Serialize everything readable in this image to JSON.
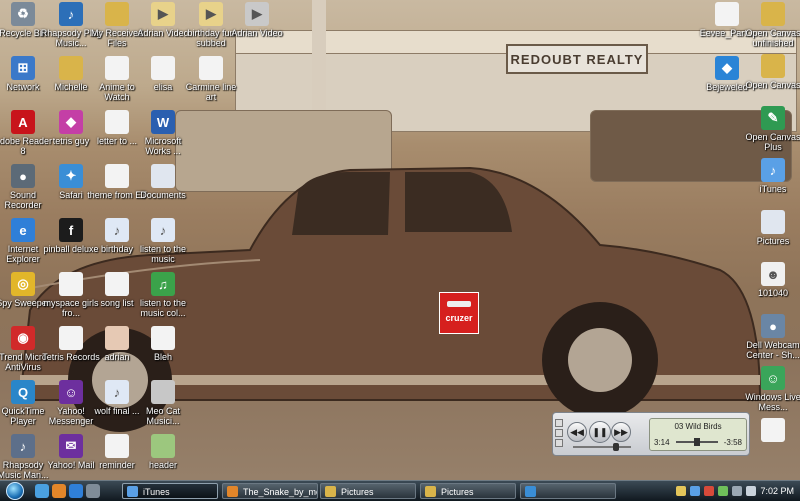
{
  "desktop": {
    "icons_left": [
      {
        "label": "Recycle Bin",
        "icon": "recycle-bin-icon",
        "color": "#7b8a99",
        "glyph": "♻"
      },
      {
        "label": "Network",
        "icon": "network-icon",
        "color": "#3b79c9",
        "glyph": "⊞"
      },
      {
        "label": "Adobe Reader 8",
        "icon": "adobe-reader-icon",
        "color": "#c8141b",
        "glyph": "A"
      },
      {
        "label": "Sound Recorder",
        "icon": "sound-recorder-icon",
        "color": "#5c6a77",
        "glyph": "●"
      },
      {
        "label": "Internet Explorer",
        "icon": "internet-explorer-icon",
        "color": "#2f7fd8",
        "glyph": "e"
      },
      {
        "label": "Spy Sweeper",
        "icon": "spy-sweeper-icon",
        "color": "#e2b62a",
        "glyph": "◎"
      },
      {
        "label": "Trend Micro AntiVirus",
        "icon": "trend-micro-icon",
        "color": "#d12a2a",
        "glyph": "◉"
      },
      {
        "label": "QuickTime Player",
        "icon": "quicktime-icon",
        "color": "#2a86c9",
        "glyph": "Q"
      },
      {
        "label": "Rhapsody Music Man...",
        "icon": "rhapsody-manager-icon",
        "color": "#5d6f8a",
        "glyph": "♪"
      }
    ],
    "icons_col2": [
      {
        "label": "Rhapsody Play Music...",
        "icon": "rhapsody-icon",
        "color": "#2c6fb8",
        "glyph": "♪"
      },
      {
        "label": "Michelle",
        "icon": "folder-icon",
        "color": "#d9b44a",
        "glyph": ""
      },
      {
        "label": "tetris guy",
        "icon": "tetris-guy-icon",
        "color": "#c43fa6",
        "glyph": "◆"
      },
      {
        "label": "Safari",
        "icon": "safari-icon",
        "color": "#3a8ed6",
        "glyph": "✦"
      },
      {
        "label": "pinball deluxe",
        "icon": "pinball-icon",
        "color": "#1c1c1c",
        "glyph": "f"
      },
      {
        "label": "myspace girls fro...",
        "icon": "document-icon",
        "color": "#f3f3f3",
        "glyph": ""
      },
      {
        "label": "Tetris Records",
        "icon": "document-icon",
        "color": "#f3f3f3",
        "glyph": ""
      },
      {
        "label": "Yahoo! Messenger",
        "icon": "yahoo-messenger-icon",
        "color": "#6d2f9e",
        "glyph": "☺"
      },
      {
        "label": "Yahoo! Mail",
        "icon": "yahoo-mail-icon",
        "color": "#6d2f9e",
        "glyph": "✉"
      }
    ],
    "icons_col3": [
      {
        "label": "My Received Files",
        "icon": "folder-icon",
        "color": "#d9b44a",
        "glyph": ""
      },
      {
        "label": "Anime to Watch",
        "icon": "document-icon",
        "color": "#f3f3f3",
        "glyph": ""
      },
      {
        "label": "letter to ...",
        "icon": "document-icon",
        "color": "#f3f3f3",
        "glyph": ""
      },
      {
        "label": "theme from ET",
        "icon": "document-icon",
        "color": "#f3f3f3",
        "glyph": ""
      },
      {
        "label": "birthday",
        "icon": "audio-file-icon",
        "color": "#dfe8f5",
        "glyph": "♪"
      },
      {
        "label": "song list",
        "icon": "document-icon",
        "color": "#f3f3f3",
        "glyph": ""
      },
      {
        "label": "adrian",
        "icon": "image-file-icon",
        "color": "#e6c9b4",
        "glyph": ""
      },
      {
        "label": "wolf final ...",
        "icon": "audio-file-icon",
        "color": "#dfe8f5",
        "glyph": "♪"
      },
      {
        "label": "reminder",
        "icon": "document-icon",
        "color": "#f3f3f3",
        "glyph": ""
      }
    ],
    "icons_col4": [
      {
        "label": "Adrian Video",
        "icon": "video-file-icon",
        "color": "#e8d28a",
        "glyph": "▶"
      },
      {
        "label": "elisa",
        "icon": "document-icon",
        "color": "#f3f3f3",
        "glyph": ""
      },
      {
        "label": "Microsoft Works ...",
        "icon": "works-icon",
        "color": "#2a5fb0",
        "glyph": "W"
      },
      {
        "label": "Documents",
        "icon": "documents-icon",
        "color": "#e0e6ef",
        "glyph": ""
      },
      {
        "label": "listen to the music",
        "icon": "audio-file-icon",
        "color": "#dfe8f5",
        "glyph": "♪"
      },
      {
        "label": "listen to the music col...",
        "icon": "music-icon",
        "color": "#3ba24a",
        "glyph": "♫"
      },
      {
        "label": "Bleh",
        "icon": "document-icon",
        "color": "#f3f3f3",
        "glyph": ""
      },
      {
        "label": "Meo Cat Musici...",
        "icon": "image-file-icon",
        "color": "#c7c7c7",
        "glyph": ""
      },
      {
        "label": "header",
        "icon": "image-file-icon",
        "color": "#9cc77e",
        "glyph": ""
      }
    ],
    "icons_col5": [
      {
        "label": "birthday fun subbed",
        "icon": "video-file-icon",
        "color": "#e8d28a",
        "glyph": "▶"
      },
      {
        "label": "Carmine line art",
        "icon": "document-icon",
        "color": "#f3f3f3",
        "glyph": ""
      }
    ],
    "icons_col6": [
      {
        "label": "Adrian Video",
        "icon": "video-file-icon",
        "color": "#c9c9c9",
        "glyph": "▶"
      }
    ],
    "icons_right1": [
      {
        "label": "Eevee_Part...",
        "icon": "document-icon",
        "color": "#f3f3f3",
        "glyph": ""
      },
      {
        "label": "Bejeweled",
        "icon": "bejeweled-icon",
        "color": "#2a84d6",
        "glyph": "◆"
      }
    ],
    "icons_right2": [
      {
        "label": "Open Canvas unfinished",
        "icon": "folder-icon",
        "color": "#d9b44a",
        "glyph": ""
      },
      {
        "label": "Open Canvas",
        "icon": "folder-icon",
        "color": "#d9b44a",
        "glyph": ""
      },
      {
        "label": "Open Canvas Plus",
        "icon": "open-canvas-icon",
        "color": "#2f9a52",
        "glyph": "✎"
      },
      {
        "label": "iTunes",
        "icon": "itunes-icon",
        "color": "#5aa0e6",
        "glyph": "♪"
      },
      {
        "label": "Pictures",
        "icon": "pictures-icon",
        "color": "#e0e6ef",
        "glyph": ""
      },
      {
        "label": "101040",
        "icon": "image-file-icon",
        "color": "#f0f0f0",
        "glyph": "☻"
      },
      {
        "label": "Dell Webcam Center - Sh...",
        "icon": "webcam-icon",
        "color": "#6a86a5",
        "glyph": "●"
      },
      {
        "label": "Windows Live Mess...",
        "icon": "windows-live-messenger-icon",
        "color": "#3aa55a",
        "glyph": "☺"
      },
      {
        "label": "",
        "icon": "blank-icon",
        "color": "#f3f3f3",
        "glyph": ""
      }
    ],
    "wallpaper_sign": "REDOUBT REALTY",
    "cruzer_label": "cruzer"
  },
  "player": {
    "track": "03 Wild Birds",
    "elapsed": "3:14",
    "remaining": "-3:58"
  },
  "taskbar": {
    "tasks": [
      {
        "label": "iTunes",
        "active": true,
        "color": "#5aa0e6"
      },
      {
        "label": "The_Snake_by_mess...",
        "active": false,
        "color": "#e2862a"
      },
      {
        "label": "Pictures",
        "active": false,
        "color": "#d9b44a"
      },
      {
        "label": "Pictures",
        "active": false,
        "color": "#d9b44a"
      },
      {
        "label": "",
        "active": false,
        "color": "#3a8ed6"
      }
    ],
    "clock": "7:02 PM"
  }
}
